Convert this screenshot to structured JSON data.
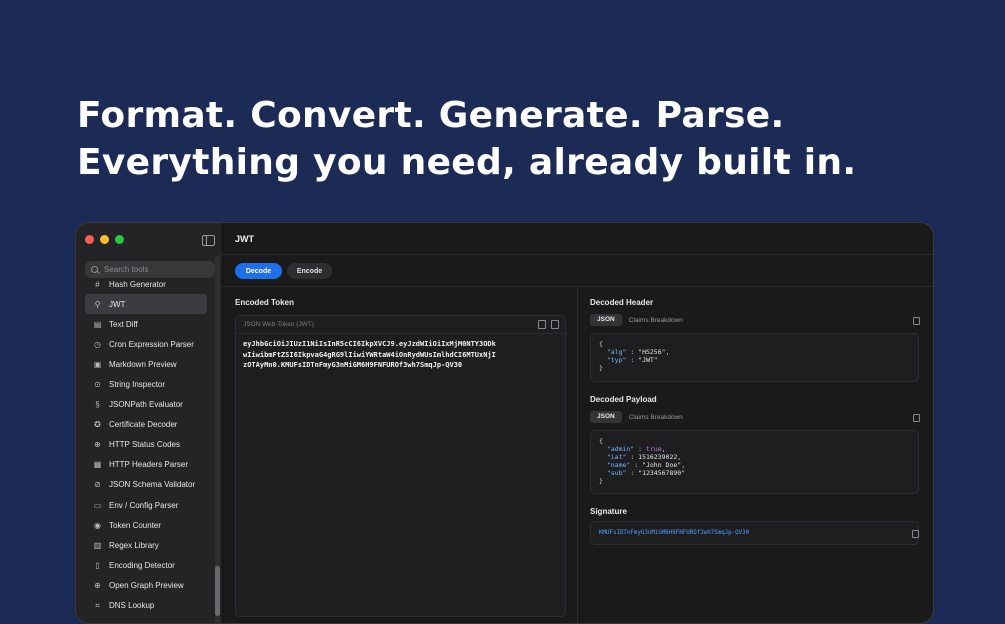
{
  "headline": {
    "line1": "Format. Convert. Generate. Parse.",
    "line2": "Everything you need, already built in."
  },
  "colors": {
    "background": "#1c2b55",
    "accent": "#1f6feb",
    "traffic_red": "#ff5f57",
    "traffic_yellow": "#febc2e",
    "traffic_green": "#28c840"
  },
  "sidebar": {
    "search_placeholder": "Search tools",
    "items": [
      {
        "label": "Hash Generator",
        "icon": "hash-icon",
        "active": false
      },
      {
        "label": "JWT",
        "icon": "key-icon",
        "active": true
      },
      {
        "label": "Text Diff",
        "icon": "document-icon",
        "active": false
      },
      {
        "label": "Cron Expression Parser",
        "icon": "clock-icon",
        "active": false
      },
      {
        "label": "Markdown Preview",
        "icon": "markdown-icon",
        "active": false
      },
      {
        "label": "String Inspector",
        "icon": "magnifier-icon",
        "active": false
      },
      {
        "label": "JSONPath Evaluator",
        "icon": "path-icon",
        "active": false
      },
      {
        "label": "Certificate Decoder",
        "icon": "certificate-icon",
        "active": false
      },
      {
        "label": "HTTP Status Codes",
        "icon": "globe-icon",
        "active": false
      },
      {
        "label": "HTTP Headers Parser",
        "icon": "headers-icon",
        "active": false
      },
      {
        "label": "JSON Schema Validator",
        "icon": "check-shield-icon",
        "active": false
      },
      {
        "label": "Env / Config Parser",
        "icon": "config-icon",
        "active": false
      },
      {
        "label": "Token Counter",
        "icon": "counter-icon",
        "active": false
      },
      {
        "label": "Regex Library",
        "icon": "library-icon",
        "active": false
      },
      {
        "label": "Encoding Detector",
        "icon": "file-icon",
        "active": false
      },
      {
        "label": "Open Graph Preview",
        "icon": "globe-icon",
        "active": false
      },
      {
        "label": "DNS Lookup",
        "icon": "network-icon",
        "active": false
      }
    ]
  },
  "main": {
    "title": "JWT",
    "mode_tabs": {
      "decode": "Decode",
      "encode": "Encode"
    },
    "encoded": {
      "title": "Encoded Token",
      "placeholder_label": "JSON Web Token (JWT)",
      "token_lines": [
        "eyJhbGciOiJIUzI1NiIsInR5cCI6IkpXVCJ9.eyJzdWIiOiIxMjM0NTY3ODk",
        "wIiwibmFtZSI6IkpvaG4gRG9lIiwiYWRtaW4iOnRydWUsImlhdCI6MTUxNjI",
        "zOTAyMn0.KMUFsIDTnFmyG3nMiGM6H9FNFUROf3wh7SmqJp-QV30"
      ]
    },
    "header": {
      "title": "Decoded Header",
      "tab_json": "JSON",
      "tab_claims": "Claims Breakdown",
      "lines": [
        {
          "key": "\"alg\"",
          "value": "\"HS256\"",
          "comma": true
        },
        {
          "key": "\"typ\"",
          "value": "\"JWT\"",
          "comma": false
        }
      ]
    },
    "payload": {
      "title": "Decoded Payload",
      "tab_json": "JSON",
      "tab_claims": "Claims Breakdown",
      "lines": [
        {
          "key": "\"admin\"",
          "value": "true",
          "comma": true
        },
        {
          "key": "\"iat\"",
          "value": "1516239022",
          "comma": true
        },
        {
          "key": "\"name\"",
          "value": "\"John Doe\"",
          "comma": true
        },
        {
          "key": "\"sub\"",
          "value": "\"1234567890\"",
          "comma": false
        }
      ]
    },
    "signature": {
      "title": "Signature",
      "value": "KMUFsIDTnFmyG3nMiGM6H9FNFUROf3wh7SmqJp-QV30"
    }
  }
}
